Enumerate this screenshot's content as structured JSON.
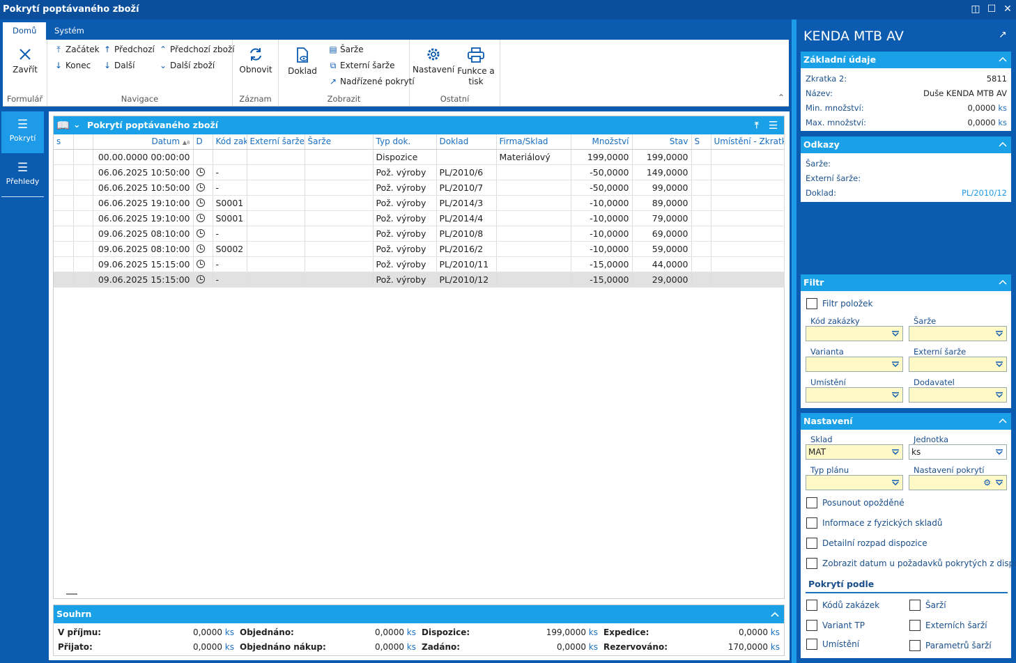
{
  "window": {
    "title": "Pokrytí poptávaného zboží"
  },
  "tabs": [
    {
      "label": "Domů"
    },
    {
      "label": "Systém"
    }
  ],
  "ribbon": {
    "formular": {
      "label": "Formulář",
      "close": "Zavřít"
    },
    "navigace": {
      "label": "Navigace",
      "zacatek": "Začátek",
      "konec": "Konec",
      "predchozi": "Předchozí",
      "dalsi": "Další",
      "predchozi_zbozi": "Předchozí zboží",
      "dalsi_zbozi": "Další zboží"
    },
    "zaznam": {
      "label": "Záznam",
      "obnovit": "Obnovit"
    },
    "zobrazit": {
      "label": "Zobrazit",
      "doklad": "Doklad",
      "sarze": "Šarže",
      "externi_sarze": "Externí šarže",
      "nadrizene": "Nadřízené pokrytí"
    },
    "ostatni": {
      "label": "Ostatní",
      "nastaveni": "Nastavení",
      "funkce_line1": "Funkce a",
      "funkce_line2": "tisk"
    }
  },
  "leftnav": [
    {
      "label": "Pokrytí"
    },
    {
      "label": "Přehledy"
    }
  ],
  "grid": {
    "title": "Pokrytí poptávaného zboží",
    "columns": [
      "s",
      "",
      "Datum",
      "D",
      "Kód zakázky",
      "Externí šarže",
      "Šarže",
      "Typ dok.",
      "Doklad",
      "Firma/Sklad",
      "Množství",
      "Stav",
      "S",
      "Umístění - Zkratka"
    ],
    "rows": [
      {
        "datum": "00.00.0000 00:00:00",
        "clock": false,
        "kod": "",
        "typ": "Dispozice",
        "doklad": "",
        "firma": "Materiálový",
        "mnozstvi": "199,0000",
        "stav": "199,0000"
      },
      {
        "datum": "06.06.2025 10:50:00",
        "clock": true,
        "kod": "-",
        "typ": "Pož. výroby",
        "doklad": "PL/2010/6",
        "firma": "",
        "mnozstvi": "-50,0000",
        "stav": "149,0000"
      },
      {
        "datum": "06.06.2025 10:50:00",
        "clock": true,
        "kod": "-",
        "typ": "Pož. výroby",
        "doklad": "PL/2010/7",
        "firma": "",
        "mnozstvi": "-50,0000",
        "stav": "99,0000"
      },
      {
        "datum": "06.06.2025 19:10:00",
        "clock": true,
        "kod": "S0001",
        "typ": "Pož. výroby",
        "doklad": "PL/2014/3",
        "firma": "",
        "mnozstvi": "-10,0000",
        "stav": "89,0000"
      },
      {
        "datum": "06.06.2025 19:10:00",
        "clock": true,
        "kod": "S0001",
        "typ": "Pož. výroby",
        "doklad": "PL/2014/4",
        "firma": "",
        "mnozstvi": "-10,0000",
        "stav": "79,0000"
      },
      {
        "datum": "09.06.2025 08:10:00",
        "clock": true,
        "kod": "-",
        "typ": "Pož. výroby",
        "doklad": "PL/2010/8",
        "firma": "",
        "mnozstvi": "-10,0000",
        "stav": "69,0000"
      },
      {
        "datum": "09.06.2025 08:10:00",
        "clock": true,
        "kod": "S0002",
        "typ": "Pož. výroby",
        "doklad": "PL/2016/2",
        "firma": "",
        "mnozstvi": "-10,0000",
        "stav": "59,0000"
      },
      {
        "datum": "09.06.2025 15:15:00",
        "clock": true,
        "kod": "-",
        "typ": "Pož. výroby",
        "doklad": "PL/2010/11",
        "firma": "",
        "mnozstvi": "-15,0000",
        "stav": "44,0000"
      },
      {
        "datum": "09.06.2025 15:15:00",
        "clock": true,
        "kod": "-",
        "typ": "Pož. výroby",
        "doklad": "PL/2010/12",
        "firma": "",
        "mnozstvi": "-15,0000",
        "stav": "29,0000",
        "selected": true
      }
    ]
  },
  "summary": {
    "title": "Souhrn",
    "cells": [
      {
        "label": "V příjmu:",
        "value": "0,0000",
        "unit": "ks"
      },
      {
        "label": "Objednáno:",
        "value": "0,0000",
        "unit": "ks"
      },
      {
        "label": "Dispozice:",
        "value": "199,0000",
        "unit": "ks"
      },
      {
        "label": "Expedice:",
        "value": "0,0000",
        "unit": "ks"
      },
      {
        "label": "Přijato:",
        "value": "0,0000",
        "unit": "ks"
      },
      {
        "label": "Objednáno nákup:",
        "value": "0,0000",
        "unit": "ks"
      },
      {
        "label": "Zadáno:",
        "value": "0,0000",
        "unit": "ks"
      },
      {
        "label": "Rezervováno:",
        "value": "170,0000",
        "unit": "ks"
      }
    ]
  },
  "right": {
    "title": "KENDA MTB AV",
    "zakladni": {
      "title": "Základní údaje",
      "zkratka_label": "Zkratka 2:",
      "zkratka": "5811",
      "nazev_label": "Název:",
      "nazev": "Duše KENDA MTB AV",
      "min_label": "Min. množství:",
      "min": "0,0000",
      "min_unit": "ks",
      "max_label": "Max. množství:",
      "max": "0,0000",
      "max_unit": "ks"
    },
    "odkazy": {
      "title": "Odkazy",
      "sarze_label": "Šarže:",
      "ext_label": "Externí šarže:",
      "doklad_label": "Doklad:",
      "doklad": "PL/2010/12"
    },
    "filtr": {
      "title": "Filtr",
      "polozek": "Filtr položek",
      "kod": "Kód zakázky",
      "sarze": "Šarže",
      "varianta": "Varianta",
      "ext": "Externí šarže",
      "umisteni": "Umístění",
      "dodavatel": "Dodavatel"
    },
    "nastaveni": {
      "title": "Nastavení",
      "sklad": "Sklad",
      "sklad_value": "MAT",
      "jednotka": "Jednotka",
      "jednotka_value": "ks",
      "typ": "Typ plánu",
      "nast_pokryti": "Nastavení pokrytí",
      "posunout": "Posunout opožděné",
      "info": "Informace z fyzických skladů",
      "detail": "Detailní rozpad dispozice",
      "zobrazit": "Zobrazit datum u požadavků pokrytých z dispozi...",
      "pokryti_podle": "Pokrytí podle",
      "kodu": "Kódů zakázek",
      "sarzi": "Šarží",
      "variant": "Variant TP",
      "ext_sarzi": "Externích šarží",
      "umisteni": "Umístění",
      "param": "Parametrů šarží"
    }
  },
  "colors": {
    "accent": "#19a0e6",
    "frame": "#0b5bb0",
    "input": "#fff9c8"
  }
}
